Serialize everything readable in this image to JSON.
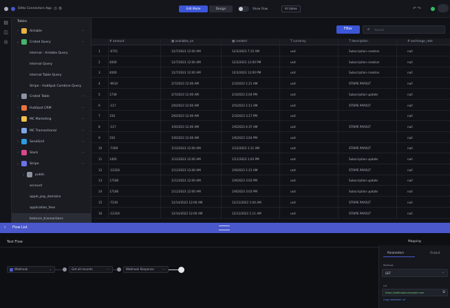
{
  "app": {
    "title": "Ditto Connectors App",
    "actions": [
      "Edit Mode",
      "Design",
      "Show Flow",
      "All tables"
    ]
  },
  "sidebar": {
    "header": "Tables",
    "items": [
      {
        "label": "Airtable",
        "color": "#e9b341",
        "level": 1,
        "twisty": "›"
      },
      {
        "label": "Crated Query",
        "color": "#46b46a",
        "level": 1,
        "twisty": "⌄"
      },
      {
        "label": "Internal - Airtable Query",
        "color": "",
        "level": 3,
        "twisty": ""
      },
      {
        "label": "Internal Query",
        "color": "",
        "level": 3,
        "twisty": ""
      },
      {
        "label": "Internal Table Query",
        "color": "",
        "level": 3,
        "twisty": ""
      },
      {
        "label": "Stripe - HubSpot Combine Query",
        "color": "",
        "level": 3,
        "twisty": ""
      },
      {
        "label": "Crated Table",
        "color": "#8d93a0",
        "level": 1,
        "twisty": "›"
      },
      {
        "label": "HubSpot CRM",
        "color": "#e8743b",
        "level": 1,
        "twisty": "›"
      },
      {
        "label": "MC Marketing",
        "color": "#f2c14a",
        "level": 1,
        "twisty": "›"
      },
      {
        "label": "MC Transactional",
        "color": "#7fa7e6",
        "level": 1,
        "twisty": "›"
      },
      {
        "label": "SendGrid",
        "color": "#2d9be0",
        "level": 1,
        "twisty": "›"
      },
      {
        "label": "Slack",
        "color": "#d8488b",
        "level": 1,
        "twisty": "›"
      },
      {
        "label": "Stripe",
        "color": "#6b73e6",
        "level": 1,
        "twisty": "⌄"
      },
      {
        "label": "public",
        "color": "#8d93a0",
        "level": 2,
        "twisty": "⌄"
      },
      {
        "label": "account",
        "color": "",
        "level": 3,
        "twisty": ""
      },
      {
        "label": "apple_pay_domains",
        "color": "",
        "level": 3,
        "twisty": ""
      },
      {
        "label": "application_fees",
        "color": "",
        "level": 3,
        "twisty": ""
      },
      {
        "label": "balance_transactions",
        "color": "",
        "level": 3,
        "twisty": ""
      }
    ]
  },
  "toolbar": {
    "filter_label": "Filter",
    "search_placeholder": "Search"
  },
  "table": {
    "columns": [
      "amount",
      "available_on",
      "created",
      "currency",
      "description",
      "exchange_rate"
    ],
    "rows": [
      [
        "1",
        "-6751",
        "12/7/2023 12:00 AM",
        "12/3/2023 7:15 AM",
        "usd",
        "Subscription creation",
        "null"
      ],
      [
        "2",
        "4000",
        "12/7/2023 12:00 AM",
        "12/3/2023 12:00 PM",
        "usd",
        "Subscription creation",
        "null"
      ],
      [
        "3",
        "4000",
        "12/7/2023 12:00 AM",
        "12/3/2023 12:00 PM",
        "usd",
        "Subscription creation",
        "null"
      ],
      [
        "4",
        "-9610",
        "2/7/2023 12:00 AM",
        "2/3/2023 1:21 AM",
        "usd",
        "STRIPE PAYOUT",
        "null"
      ],
      [
        "5",
        "1730",
        "2/7/2023 12:00 AM",
        "2/3/2023 2:04 PM",
        "usd",
        "Subscription update",
        "null"
      ],
      [
        "6",
        "-117",
        "2/6/2023 12:00 AM",
        "2/5/2023 1:11 AM",
        "usd",
        "STRIPE PAYOUT",
        "null"
      ],
      [
        "7",
        "150",
        "2/6/2023 12:00 AM",
        "2/3/2023 3:17 PM",
        "usd",
        "",
        "null"
      ],
      [
        "8",
        "-117",
        "1/9/2023 12:00 AM",
        "1/6/2023 4:37 AM",
        "usd",
        "STRIPE PAYOUT",
        "null"
      ],
      [
        "9",
        "150",
        "1/9/2023 12:00 AM",
        "1/6/2023 3:04 PM",
        "usd",
        "",
        "null"
      ],
      [
        "10",
        "-7309",
        "1/13/2023 12:00 AM",
        "1/12/2023 1:11 AM",
        "usd",
        "STRIPE PAYOUT",
        "null"
      ],
      [
        "11",
        "1405",
        "1/13/2023 12:00 AM",
        "1/11/2023 1:03 PM",
        "usd",
        "Subscription update",
        "null"
      ],
      [
        "12",
        "-12318",
        "1/11/2023 12:00 AM",
        "1/9/2023 1:21 AM",
        "usd",
        "STRIPE PAYOUT",
        "null"
      ],
      [
        "13",
        "17180",
        "1/11/2023 12:00 AM",
        "1/9/2023 3:03 PM",
        "usd",
        "Subscription update",
        "null"
      ],
      [
        "14",
        "17180",
        "1/11/2023 12:00 AM",
        "1/9/2023 3:03 PM",
        "usd",
        "Subscription update",
        "null"
      ],
      [
        "15",
        "-7230",
        "12/14/2022 12:00 AM",
        "12/12/2022 1:04 AM",
        "usd",
        "STRIPE PAYOUT",
        "null"
      ],
      [
        "16",
        "-12318",
        "12/14/2022 12:00 AM",
        "12/12/2022 1:11 AM",
        "usd",
        "STRIPE PAYOUT",
        "null"
      ]
    ]
  },
  "flowbar": {
    "label": "Flow List"
  },
  "flow": {
    "title": "Test Flow",
    "mapping_label": "Mapping",
    "nodes": [
      "Webhook",
      "Get all records",
      "Webhook Response"
    ],
    "tabs": [
      "Parameters",
      "Output"
    ],
    "method_label": "Method",
    "method_value": "GET",
    "url_label": "Url",
    "url_value": "https://webhooks.example.com",
    "url_link": "Copy webhook url"
  },
  "colors": {
    "accent": "#4a58cc",
    "filter": "#3c56d8"
  }
}
